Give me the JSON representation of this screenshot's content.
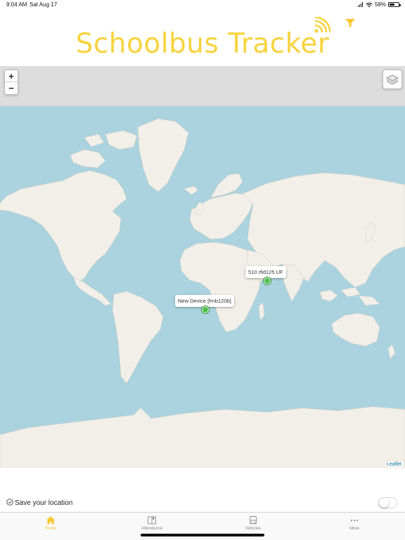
{
  "status_bar": {
    "time": "9:04 AM",
    "date": "Sat Aug 17",
    "battery": "58%",
    "battery_level": 0.58
  },
  "header": {
    "title": "Schoolbus Tracker"
  },
  "map": {
    "zoom_in": "+",
    "zoom_out": "−",
    "attribution": "Leaflet",
    "markers": [
      {
        "label": "New Device [frnb120b]"
      },
      {
        "label": "510 rfid125 UF"
      }
    ]
  },
  "location": {
    "label": "Save your location",
    "enabled": false
  },
  "tabs": [
    {
      "label": "Home",
      "icon": "home-icon",
      "active": true
    },
    {
      "label": "Attendance",
      "icon": "book-icon",
      "active": false
    },
    {
      "label": "Vehicles",
      "icon": "bus-icon",
      "active": false
    },
    {
      "label": "More",
      "icon": "more-dots-icon",
      "active": false
    }
  ],
  "colors": {
    "accent": "#f7d33e",
    "ocean": "#aad3df",
    "land": "#f2efe9",
    "marker": "#4cc24c"
  }
}
